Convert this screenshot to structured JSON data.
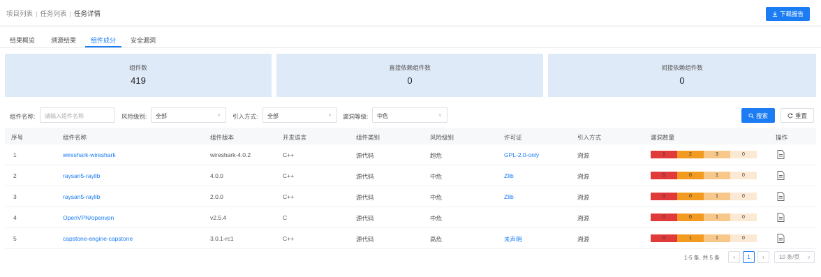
{
  "breadcrumb": {
    "item1": "项目列表",
    "sep": "|",
    "item2": "任务列表",
    "item3": "任务详情"
  },
  "header": {
    "download_label": "下载报告",
    "download_icon": "download-icon"
  },
  "tabs": [
    {
      "label": "结果概览"
    },
    {
      "label": "溯源结果"
    },
    {
      "label": "组件成分"
    },
    {
      "label": "安全漏洞"
    }
  ],
  "stats": [
    {
      "label": "组件数",
      "value": "419"
    },
    {
      "label": "直接依赖组件数",
      "value": "0"
    },
    {
      "label": "间接依赖组件数",
      "value": "0"
    }
  ],
  "filters": {
    "name_label": "组件名称:",
    "name_placeholder": "请输入组件名称",
    "risk_label": "风险级别:",
    "risk_value": "全部",
    "import_label": "引入方式:",
    "import_value": "全部",
    "vuln_label": "漏洞等级:",
    "vuln_value": "中危",
    "search_label": "搜索",
    "reset_label": "重置"
  },
  "table": {
    "headers": [
      "序号",
      "组件名称",
      "组件版本",
      "开发语言",
      "组件类别",
      "风险级别",
      "许可证",
      "引入方式",
      "漏洞数量",
      "操作"
    ],
    "rows": [
      {
        "index": "1",
        "name": "wireshark-wireshark",
        "version": "wireshark-4.0.2",
        "lang": "C++",
        "category": "源代码",
        "risk": "超危",
        "license": "GPL-2.0-only",
        "import": "溯源",
        "vulns": [
          "1",
          "2",
          "3",
          "0"
        ]
      },
      {
        "index": "2",
        "name": "raysan5-raylib",
        "version": "4.0.0",
        "lang": "C++",
        "category": "源代码",
        "risk": "中危",
        "license": "Zlib",
        "import": "溯源",
        "vulns": [
          "0",
          "0",
          "1",
          "0"
        ]
      },
      {
        "index": "3",
        "name": "raysan5-raylib",
        "version": "2.0.0",
        "lang": "C++",
        "category": "源代码",
        "risk": "中危",
        "license": "Zlib",
        "import": "溯源",
        "vulns": [
          "0",
          "0",
          "1",
          "0"
        ]
      },
      {
        "index": "4",
        "name": "OpenVPN/openvpn",
        "version": "v2.5.4",
        "lang": "C",
        "category": "源代码",
        "risk": "中危",
        "license": "",
        "import": "溯源",
        "vulns": [
          "0",
          "0",
          "1",
          "0"
        ]
      },
      {
        "index": "5",
        "name": "capstone-engine-capstone",
        "version": "3.0.1-rc1",
        "lang": "C++",
        "category": "源代码",
        "risk": "高危",
        "license": "未声明",
        "import": "溯源",
        "vulns": [
          "0",
          "1",
          "1",
          "0"
        ]
      }
    ]
  },
  "pagination": {
    "summary": "1-5 条, 共 5 条",
    "current_page": "1",
    "page_size": "10 条/页"
  },
  "colors": {
    "accent": "#1b7cf3",
    "critical": "#e03a3a",
    "high": "#f29b20",
    "medium": "#f7c88a",
    "low": "#fbe9d4"
  }
}
